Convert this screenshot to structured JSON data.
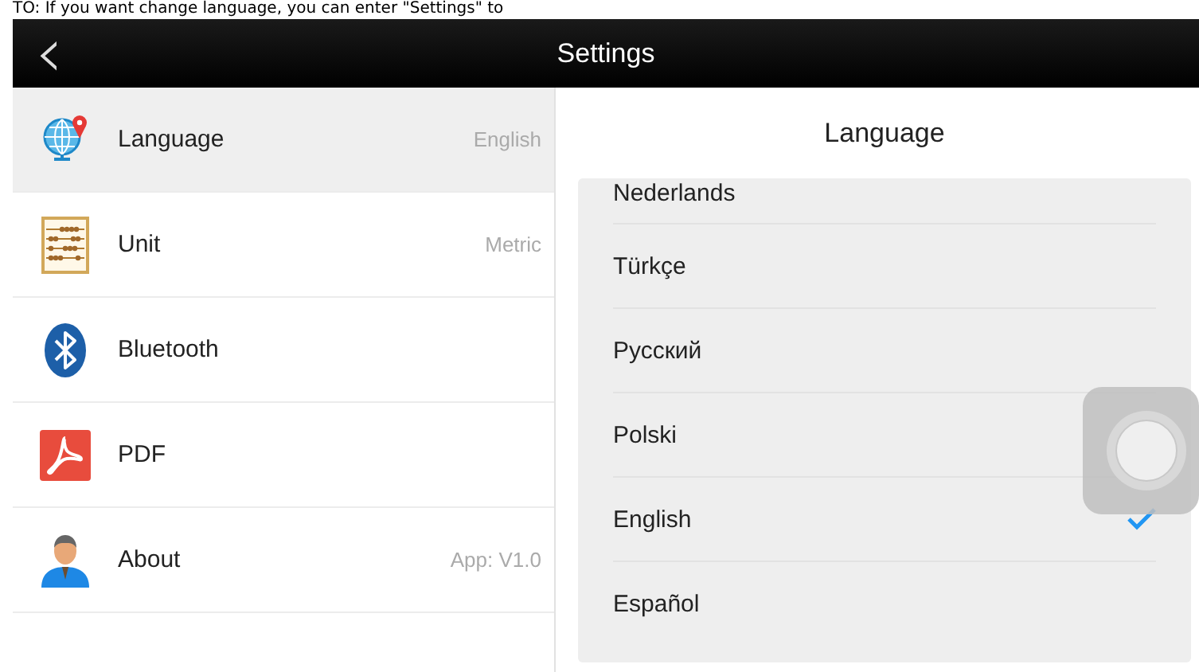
{
  "caption": "TO: If you want change language, you can enter \"Settings\" to",
  "header": {
    "back": "‹",
    "title": "Settings"
  },
  "sidebar": {
    "items": [
      {
        "kind": "globe",
        "label": "Language",
        "value": "English",
        "selected": true
      },
      {
        "kind": "abacus",
        "label": "Unit",
        "value": "Metric",
        "selected": false
      },
      {
        "kind": "bluetooth",
        "label": "Bluetooth",
        "selected": false
      },
      {
        "kind": "pdf",
        "label": "PDF",
        "selected": false
      },
      {
        "kind": "person",
        "label": "About",
        "value": "App: V1.0",
        "selected": false
      }
    ]
  },
  "detail": {
    "title": "Language",
    "options": [
      {
        "label": "Nederlands",
        "selected": false
      },
      {
        "label": "Türkçe",
        "selected": false
      },
      {
        "label": "Русский",
        "selected": false
      },
      {
        "label": "Polski",
        "selected": false
      },
      {
        "label": "English",
        "selected": true
      },
      {
        "label": "Español",
        "selected": false
      }
    ]
  }
}
